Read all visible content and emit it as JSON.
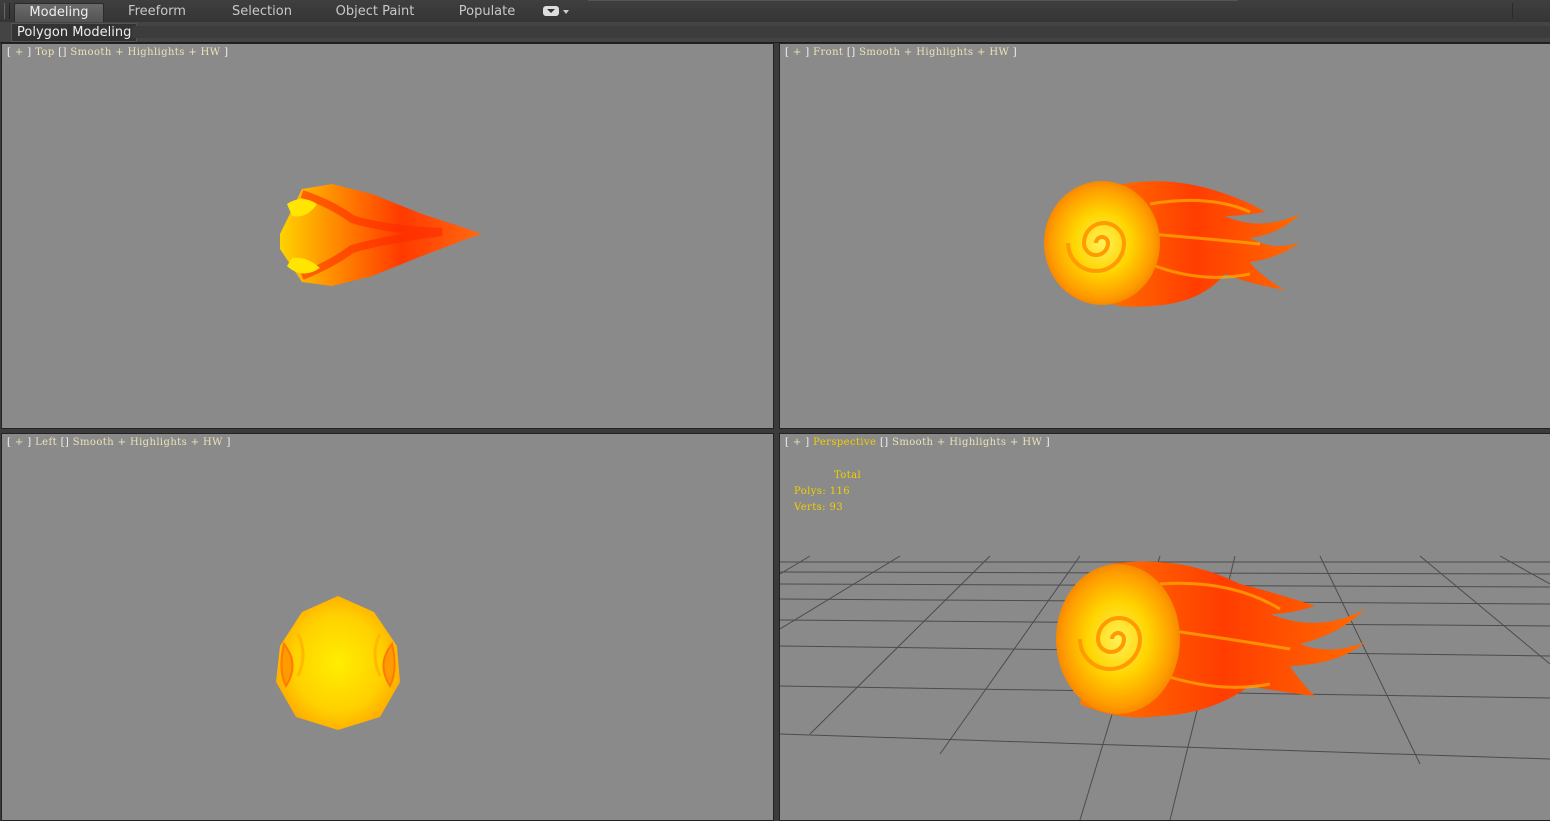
{
  "ribbon": {
    "tabs": [
      {
        "label": "Modeling",
        "active": true
      },
      {
        "label": "Freeform",
        "active": false
      },
      {
        "label": "Selection",
        "active": false
      },
      {
        "label": "Object Paint",
        "active": false
      },
      {
        "label": "Populate",
        "active": false
      }
    ]
  },
  "panel": {
    "label": "Polygon Modeling"
  },
  "viewports": {
    "top": {
      "plus": "+",
      "view": "Top",
      "shading": "Smooth + Highlights + HW"
    },
    "front": {
      "plus": "+",
      "view": "Front",
      "shading": "Smooth + Highlights + HW"
    },
    "left": {
      "plus": "+",
      "view": "Left",
      "shading": "Smooth + Highlights + HW"
    },
    "perspective": {
      "plus": "+",
      "view": "Perspective",
      "shading": "Smooth + Highlights + HW",
      "stats": {
        "total_label": "Total",
        "polys_label": "Polys:",
        "polys": "116",
        "verts_label": "Verts:",
        "verts": "93"
      }
    }
  },
  "colors": {
    "viewport_bg": "#8a8a8a",
    "active_view": "#f0d000",
    "flame_outer": "#ff3300",
    "flame_mid": "#ff8800",
    "flame_core": "#ffdd00"
  },
  "icons": {
    "workspace_dropdown": "dropdown-icon"
  }
}
